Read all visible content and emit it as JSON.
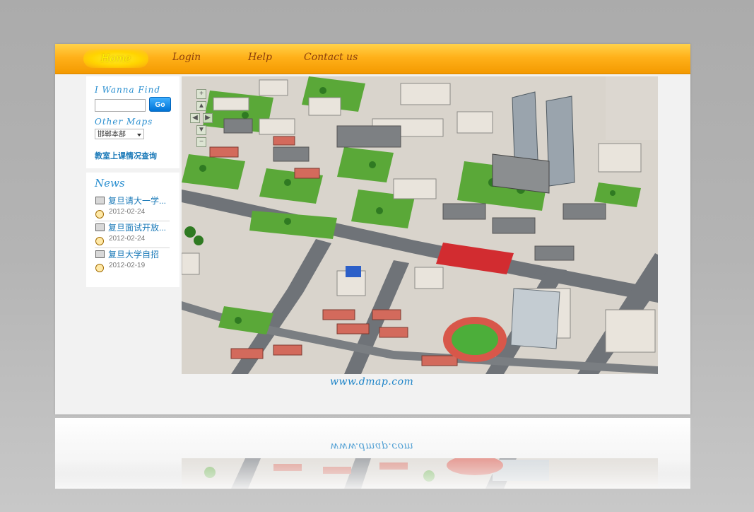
{
  "nav": {
    "items": [
      {
        "label": "Home",
        "active": true
      },
      {
        "label": "Login"
      },
      {
        "label": "Help"
      },
      {
        "label": "Contact us"
      }
    ]
  },
  "search": {
    "title": "I Wanna Find",
    "placeholder": "",
    "button_label": "Go"
  },
  "maps": {
    "title": "Other Maps",
    "selected": "邯郸本部"
  },
  "classroom_link": "教室上课情况查询",
  "news": {
    "title": "News",
    "items": [
      {
        "title": "复旦请大一学...",
        "date": "2012-02-24"
      },
      {
        "title": "复旦面试开放...",
        "date": "2012-02-24"
      },
      {
        "title": "复旦大学自招",
        "date": "2012-02-19"
      }
    ]
  },
  "map": {
    "controls": [
      "+",
      "▲",
      "◀",
      "▶",
      "▼",
      "−"
    ]
  },
  "footer": {
    "url": "www.dmap.com"
  },
  "colors": {
    "nav_orange": "#ffb11a",
    "nav_text": "#8a3e0c",
    "link_blue": "#1a79b8",
    "heading_blue": "#2a8fd0"
  }
}
